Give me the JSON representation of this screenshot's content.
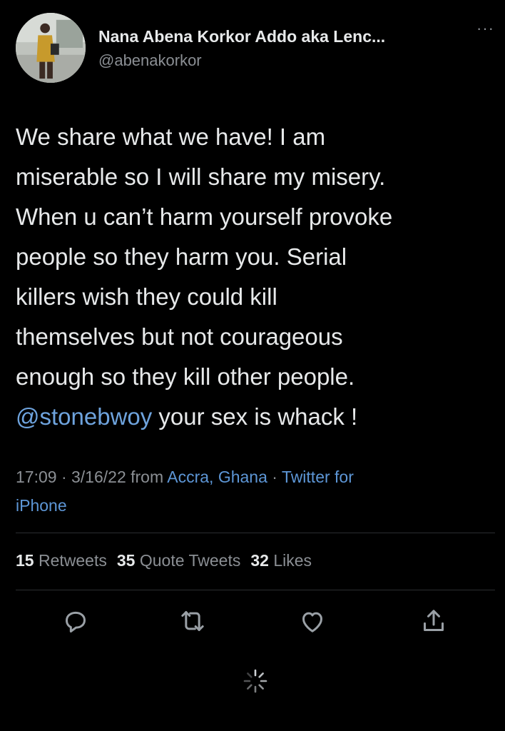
{
  "author": {
    "display_name": "Nana Abena Korkor Addo aka Lenc...",
    "handle": "@abenakorkor",
    "avatar_icon": "profile-photo"
  },
  "more_icon": "more-dots-icon",
  "tweet": {
    "lines": [
      "We share what we have! I am",
      "miserable so I will share my misery.",
      "When u can’t harm yourself provoke",
      "people so they harm you. Serial",
      "killers wish they could kill",
      "themselves but not courageous",
      "enough so they kill other people."
    ],
    "mention": "@stonebwoy",
    "last_line_rest": " your sex is whack !"
  },
  "meta": {
    "time": "17:09 · 3/16/22 from ",
    "location": "Accra, Ghana",
    "separator": " · ",
    "source_line1": "Twitter for",
    "source_line2": "iPhone"
  },
  "stats": {
    "retweets_count": "15",
    "retweets_label": "Retweets",
    "quotes_count": "35",
    "quotes_label": "Quote Tweets",
    "likes_count": "32",
    "likes_label": "Likes"
  },
  "actions": {
    "reply_icon": "reply-icon",
    "retweet_icon": "retweet-icon",
    "like_icon": "heart-icon",
    "share_icon": "share-icon"
  },
  "loading_icon": "loading-spinner-icon",
  "colors": {
    "background": "#000000",
    "text": "#e7e9ea",
    "secondary": "#8b8f94",
    "link": "#6ea3dd",
    "divider": "#2b2d30"
  }
}
